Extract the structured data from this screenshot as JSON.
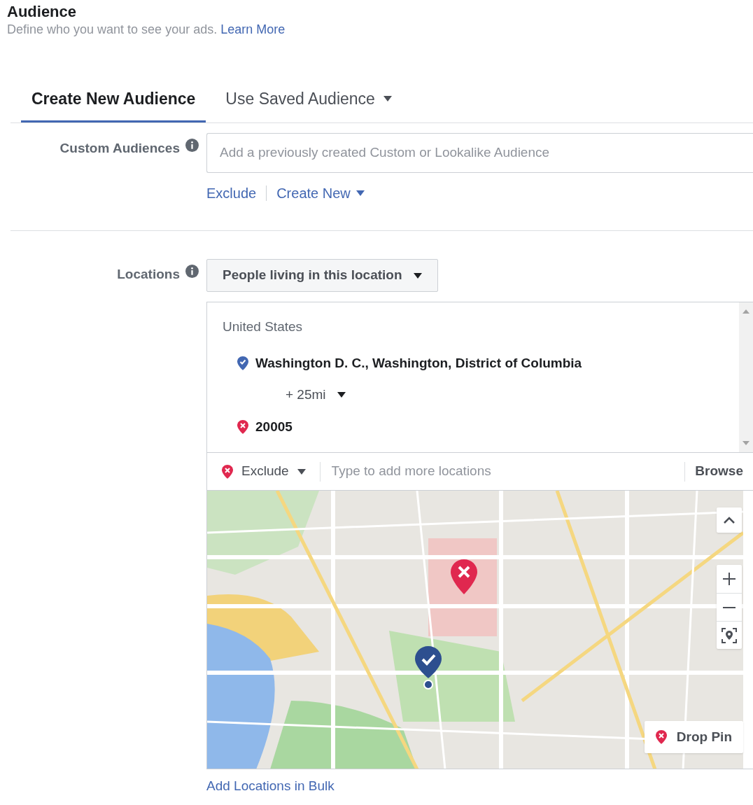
{
  "header": {
    "title": "Audience",
    "description": "Define who you want to see your ads.",
    "learn_more": "Learn More"
  },
  "tabs": [
    {
      "label": "Create New Audience",
      "selected": true,
      "has_caret": false
    },
    {
      "label": "Use Saved Audience",
      "selected": false,
      "has_caret": true
    }
  ],
  "custom_audiences": {
    "label": "Custom Audiences",
    "placeholder": "Add a previously created Custom or Lookalike Audience",
    "links": [
      {
        "label": "Exclude",
        "has_caret": false
      },
      {
        "label": "Create New",
        "has_caret": true
      }
    ]
  },
  "locations": {
    "label": "Locations",
    "mode": "People living in this location",
    "group": "United States",
    "items": [
      {
        "kind": "include",
        "name": "Washington D. C., Washington, District of Columbia",
        "radius": "+ 25mi"
      },
      {
        "kind": "exclude",
        "name": "20005"
      }
    ],
    "search": {
      "mode": "Exclude",
      "placeholder": "Type to add more locations",
      "browse": "Browse"
    },
    "map": {
      "drop_pin": "Drop Pin"
    },
    "bulk_link": "Add Locations in Bulk"
  }
}
